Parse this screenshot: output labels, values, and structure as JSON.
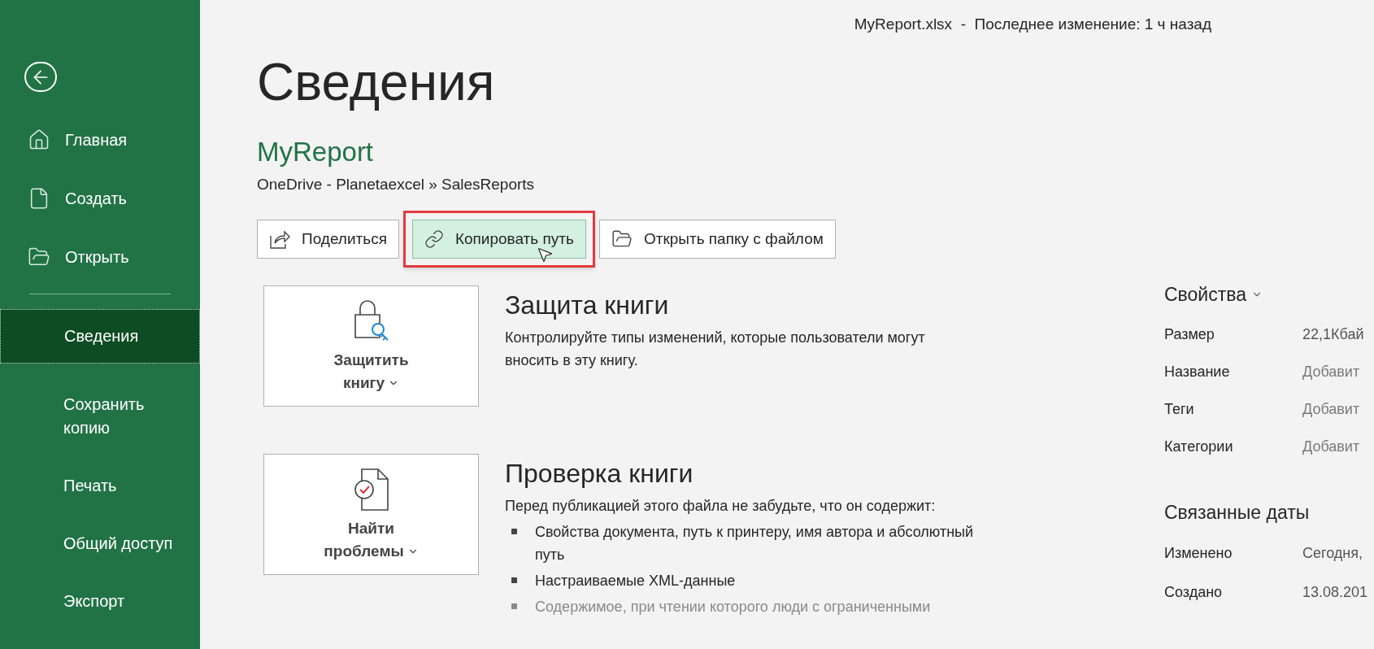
{
  "header": {
    "file_status": "MyReport.xlsx  -  Последнее изменение: 1 ч назад"
  },
  "sidebar": {
    "top_items": [
      {
        "label": "Главная",
        "kind": "home",
        "selected": false
      },
      {
        "label": "Создать",
        "kind": "new",
        "selected": false
      },
      {
        "label": "Открыть",
        "kind": "open",
        "selected": false
      }
    ],
    "items": [
      {
        "label": "Сведения",
        "selected": true
      },
      {
        "label": "Сохранить копию",
        "selected": false
      },
      {
        "label": "Печать",
        "selected": false
      },
      {
        "label": "Общий доступ",
        "selected": false
      },
      {
        "label": "Экспорт",
        "selected": false
      }
    ]
  },
  "page": {
    "title": "Сведения",
    "document_name": "MyReport",
    "location": "OneDrive - Planetaexcel » SalesReports",
    "actions": [
      {
        "label": "Поделиться",
        "kind": "share",
        "highlighted": false
      },
      {
        "label": "Копировать путь",
        "kind": "link",
        "highlighted": true
      },
      {
        "label": "Открыть папку с файлом",
        "kind": "folder",
        "highlighted": false
      }
    ],
    "sections": [
      {
        "kind": "protect",
        "button_lines": [
          "Защитить",
          "книгу"
        ],
        "title": "Защита книги",
        "description": "Контролируйте типы изменений, которые пользователи могут вносить в эту книгу."
      },
      {
        "kind": "inspect",
        "button_lines": [
          "Найти",
          "проблемы"
        ],
        "title": "Проверка книги",
        "description": "Перед публикацией этого файла не забудьте, что он содержит:",
        "bullets": [
          {
            "text": "Свойства документа, путь к принтеру, имя автора и абсолютный путь",
            "faded": false
          },
          {
            "text": "Настраиваемые XML-данные",
            "faded": false
          },
          {
            "text": "Содержимое, при чтении которого люди с ограниченными",
            "faded": true
          }
        ]
      }
    ]
  },
  "properties": {
    "title": "Свойства",
    "rows": [
      {
        "label": "Размер",
        "value": "22,1Кбай",
        "kind": "value"
      },
      {
        "label": "Название",
        "value": "Добавит",
        "kind": "placeholder"
      },
      {
        "label": "Теги",
        "value": "Добавит",
        "kind": "placeholder"
      },
      {
        "label": "Категории",
        "value": "Добавит",
        "kind": "placeholder"
      }
    ]
  },
  "related_dates": {
    "title": "Связанные даты",
    "rows": [
      {
        "label": "Изменено",
        "value": "Сегодня,",
        "kind": "value"
      },
      {
        "label": "Создано",
        "value": "13.08.201",
        "kind": "value"
      }
    ]
  }
}
